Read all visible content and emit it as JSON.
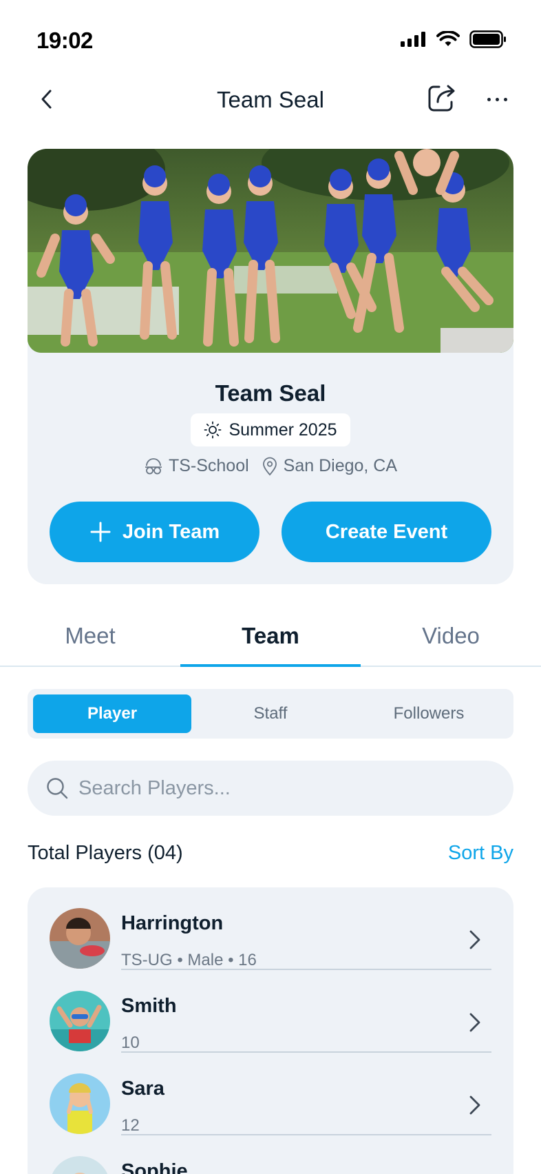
{
  "status_bar": {
    "time": "19:02"
  },
  "nav": {
    "title": "Team Seal"
  },
  "team": {
    "name": "Team Seal",
    "season": "Summer 2025",
    "school": "TS-School",
    "location": "San Diego, CA",
    "join_label": "Join Team",
    "create_event_label": "Create Event"
  },
  "tabs": [
    {
      "label": "Meet"
    },
    {
      "label": "Team"
    },
    {
      "label": "Video"
    }
  ],
  "active_tab": "Team",
  "segments": [
    {
      "label": "Player"
    },
    {
      "label": "Staff"
    },
    {
      "label": "Followers"
    }
  ],
  "active_segment": "Player",
  "search": {
    "placeholder": "Search Players..."
  },
  "list_header": {
    "total_label": "Total Players (04)",
    "sort_label": "Sort By"
  },
  "players": [
    {
      "name": "Harrington",
      "meta": "TS-UG • Male • 16"
    },
    {
      "name": "Smith",
      "meta": "10"
    },
    {
      "name": "Sara",
      "meta": "12"
    },
    {
      "name": "Sophie",
      "meta": ""
    }
  ],
  "colors": {
    "accent": "#0ea5e9",
    "card_bg": "#eef2f7",
    "text": "#0f1f2e",
    "muted": "#64748b"
  }
}
